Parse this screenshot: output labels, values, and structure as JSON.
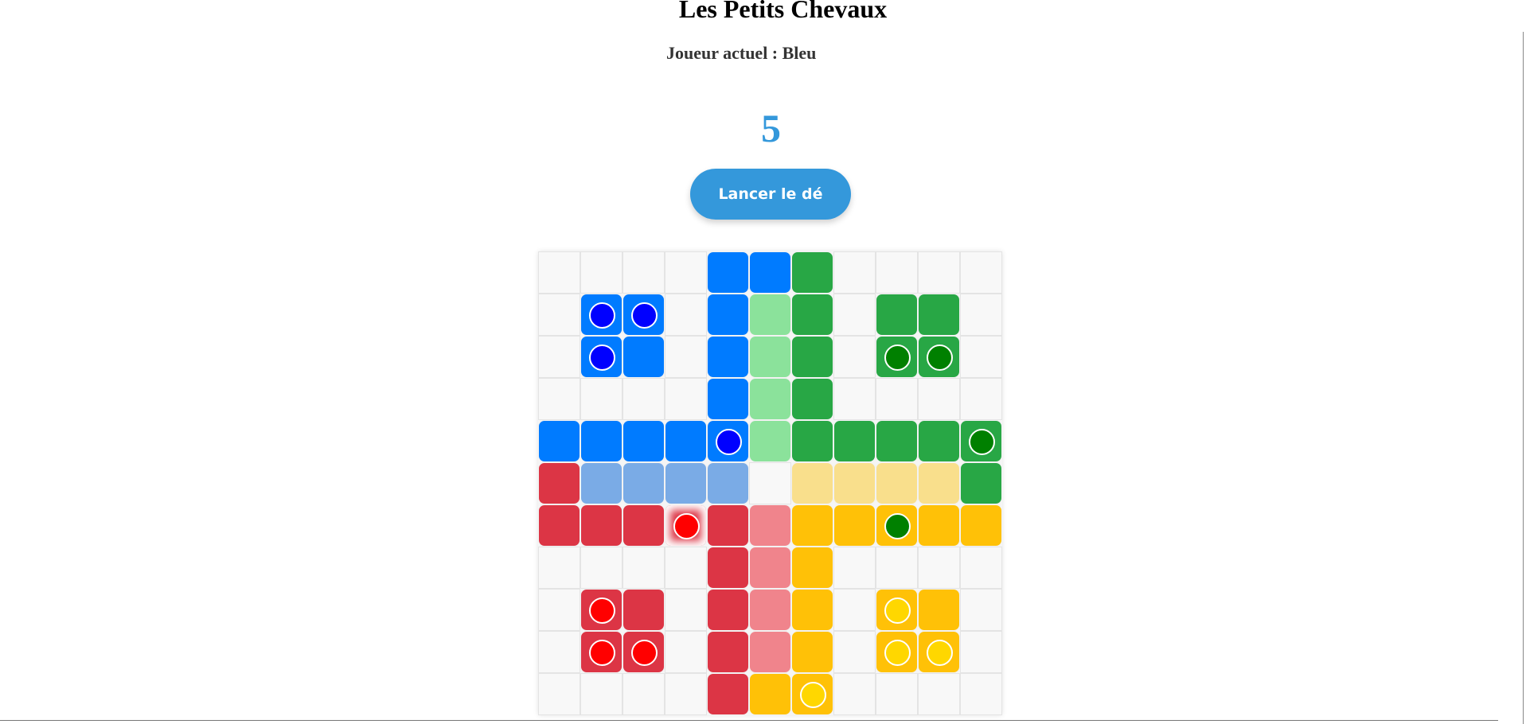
{
  "header": {
    "title": "Les Petits Chevaux",
    "current_player_label": "Joueur actuel : Bleu"
  },
  "dice": {
    "value": "5",
    "roll_label": "Lancer le dé"
  },
  "colors": {
    "blue": "#007bff",
    "blue_light": "#7aabe6",
    "green": "#28a745",
    "green_light": "#8be29b",
    "red": "#dc3545",
    "red_light": "#f0848c",
    "yellow": "#ffc107",
    "yellow_light": "#f9df8c",
    "pawn_blue": "#0000ff",
    "pawn_green": "#008000",
    "pawn_red": "#ff0000",
    "pawn_yellow": "#ffd700",
    "accent": "#3498db"
  },
  "board": {
    "size": 11,
    "grid": [
      [
        "e",
        "e",
        "e",
        "e",
        "B",
        "B",
        "G",
        "e",
        "e",
        "e",
        "e"
      ],
      [
        "e",
        "B",
        "B",
        "e",
        "B",
        "g",
        "G",
        "e",
        "G",
        "G",
        "e"
      ],
      [
        "e",
        "B",
        "B",
        "e",
        "B",
        "g",
        "G",
        "e",
        "G",
        "G",
        "e"
      ],
      [
        "e",
        "e",
        "e",
        "e",
        "B",
        "g",
        "G",
        "e",
        "e",
        "e",
        "e"
      ],
      [
        "B",
        "B",
        "B",
        "B",
        "B",
        "g",
        "G",
        "G",
        "G",
        "G",
        "G"
      ],
      [
        "R",
        "b",
        "b",
        "b",
        "b",
        "e",
        "y",
        "y",
        "y",
        "y",
        "G"
      ],
      [
        "R",
        "R",
        "R",
        "R",
        "R",
        "r",
        "Y",
        "Y",
        "Y",
        "Y",
        "Y"
      ],
      [
        "e",
        "e",
        "e",
        "e",
        "R",
        "r",
        "Y",
        "e",
        "e",
        "e",
        "e"
      ],
      [
        "e",
        "R",
        "R",
        "e",
        "R",
        "r",
        "Y",
        "e",
        "Y",
        "Y",
        "e"
      ],
      [
        "e",
        "R",
        "R",
        "e",
        "R",
        "r",
        "Y",
        "e",
        "Y",
        "Y",
        "e"
      ],
      [
        "e",
        "e",
        "e",
        "e",
        "R",
        "Y",
        "Y",
        "e",
        "e",
        "e",
        "e"
      ]
    ],
    "pawns": [
      {
        "row": 1,
        "col": 1,
        "color": "blue"
      },
      {
        "row": 1,
        "col": 2,
        "color": "blue"
      },
      {
        "row": 2,
        "col": 1,
        "color": "blue"
      },
      {
        "row": 4,
        "col": 4,
        "color": "blue"
      },
      {
        "row": 2,
        "col": 8,
        "color": "green"
      },
      {
        "row": 2,
        "col": 9,
        "color": "green"
      },
      {
        "row": 4,
        "col": 10,
        "color": "green"
      },
      {
        "row": 6,
        "col": 8,
        "color": "green"
      },
      {
        "row": 6,
        "col": 3,
        "color": "red",
        "highlight": true
      },
      {
        "row": 8,
        "col": 1,
        "color": "red"
      },
      {
        "row": 9,
        "col": 1,
        "color": "red"
      },
      {
        "row": 9,
        "col": 2,
        "color": "red"
      },
      {
        "row": 8,
        "col": 8,
        "color": "yellow"
      },
      {
        "row": 9,
        "col": 8,
        "color": "yellow"
      },
      {
        "row": 9,
        "col": 9,
        "color": "yellow"
      },
      {
        "row": 10,
        "col": 6,
        "color": "yellow"
      }
    ]
  }
}
